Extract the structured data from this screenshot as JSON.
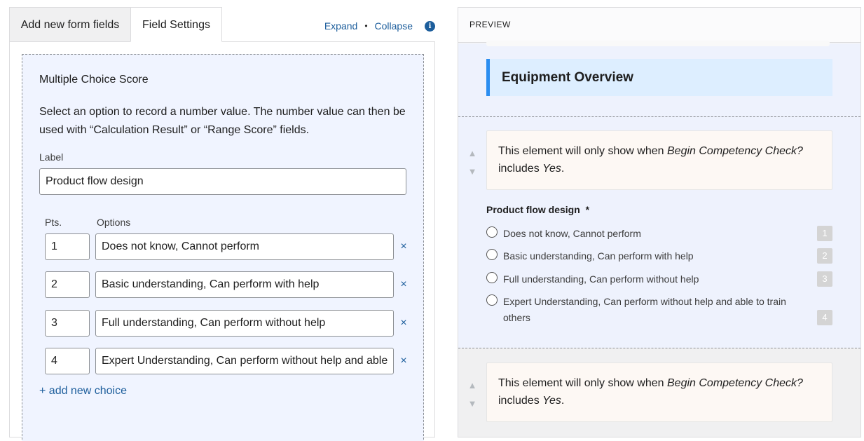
{
  "tabs": [
    {
      "label": "Add new form fields"
    },
    {
      "label": "Field Settings"
    }
  ],
  "header_links": {
    "expand": "Expand",
    "separator": "•",
    "collapse": "Collapse",
    "info": "i"
  },
  "field": {
    "title": "Multiple Choice Score",
    "description": "Select an option to record a number value. The number value can then be used with “Calculation Result” or “Range Score” fields.",
    "label_caption": "Label",
    "label_value": "Product flow design",
    "pts_header": "Pts.",
    "options_header": "Options",
    "remove_symbol": "×",
    "choices": [
      {
        "pts": "1",
        "text": "Does not know, Cannot perform"
      },
      {
        "pts": "2",
        "text": "Basic understanding, Can perform with help"
      },
      {
        "pts": "3",
        "text": "Full understanding, Can perform without help"
      },
      {
        "pts": "4",
        "text": "Expert Understanding, Can perform without help and able"
      }
    ],
    "add_choice": "+ add new choice"
  },
  "preview": {
    "title": "PREVIEW",
    "heading": "Equipment Overview",
    "condition": {
      "prefix": "This element will only show when ",
      "field": "Begin Competency Check?",
      "middle": " includes ",
      "value": "Yes",
      "suffix": "."
    },
    "question": "Product flow design",
    "required_mark": "*",
    "options": [
      {
        "text": "Does not know, Cannot perform",
        "score": "1"
      },
      {
        "text": "Basic understanding, Can perform with help",
        "score": "2"
      },
      {
        "text": "Full understanding, Can perform without help",
        "score": "3"
      },
      {
        "text": "Expert Understanding, Can perform without help and able to train others",
        "score": "4"
      }
    ],
    "up_arrow": "▲",
    "down_arrow": "▼"
  }
}
